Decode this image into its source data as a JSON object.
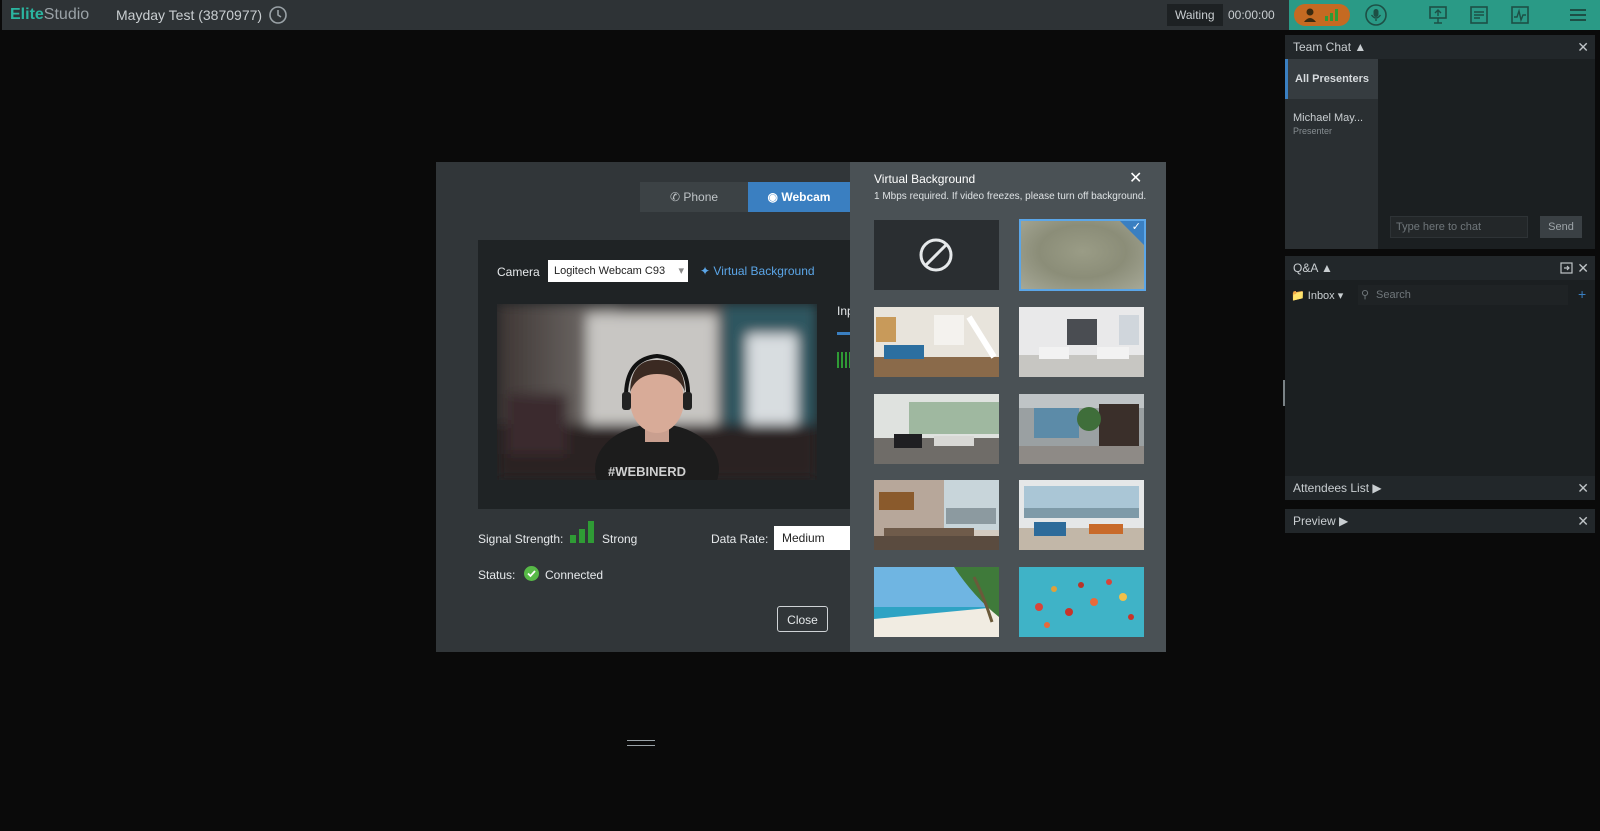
{
  "app": {
    "brand_part1": "Elite",
    "brand_part2": "Studio",
    "session_title": "Mayday Test (3870977)"
  },
  "topbar": {
    "status": "Waiting",
    "timer": "00:00:00"
  },
  "team_chat": {
    "title": "Team Chat",
    "channel": "All Presenters",
    "member_name": "Michael May...",
    "member_role": "Presenter",
    "input_placeholder": "Type here to chat",
    "send_label": "Send"
  },
  "qa": {
    "title": "Q&A",
    "inbox_label": "Inbox",
    "search_placeholder": "Search"
  },
  "attendees": {
    "title": "Attendees List"
  },
  "preview": {
    "title": "Preview"
  },
  "dialog": {
    "tabs": {
      "phone": "Phone",
      "webcam": "Webcam"
    },
    "camera_label": "Camera",
    "camera_value": "Logitech Webcam C93",
    "virtual_bg_link": "Virtual Background",
    "input_label": "Inp",
    "signal_label": "Signal Strength:",
    "signal_value": "Strong",
    "data_rate_label": "Data Rate:",
    "data_rate_value": "Medium",
    "status_label": "Status:",
    "status_value": "Connected",
    "close_label": "Close",
    "video_shirt_text": "#WEBINERD"
  },
  "virtual_background": {
    "title": "Virtual Background",
    "note": "1 Mbps required. If video freezes, please turn off background.",
    "selected": "blur",
    "options": [
      "none",
      "blur",
      "living-room",
      "white-lounge",
      "office-lounge",
      "office-plants",
      "dining-view",
      "waterfront-lounge",
      "beach",
      "hot-air-balloons"
    ]
  },
  "colors": {
    "accent": "#3a7fc1",
    "brand": "#2bb5a0",
    "success": "#2f9b35",
    "topbar_right": "#2a9a86"
  }
}
